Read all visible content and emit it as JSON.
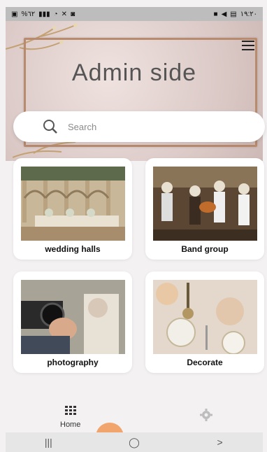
{
  "status_bar": {
    "left_text": "%٦٢",
    "time": "١٩:٢٠"
  },
  "header": {
    "title": "Admin side"
  },
  "search": {
    "placeholder": "Search"
  },
  "categories": [
    {
      "label": "wedding halls"
    },
    {
      "label": "Band group"
    },
    {
      "label": "photography"
    },
    {
      "label": "Decorate"
    }
  ],
  "bottom_nav": {
    "home_label": "Home"
  },
  "colors": {
    "accent": "#f1a56c",
    "frame": "#b88a6e"
  }
}
